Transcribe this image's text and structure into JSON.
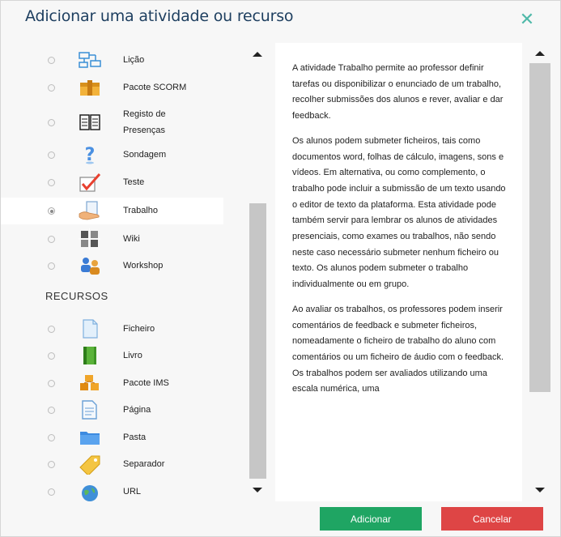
{
  "dialog": {
    "title": "Adicionar uma atividade ou recurso",
    "close_symbol": "✕"
  },
  "activities": [
    {
      "label": "Lição",
      "icon": "lesson-icon",
      "selected": false
    },
    {
      "label": "Pacote SCORM",
      "icon": "scorm-package-icon",
      "selected": false
    },
    {
      "label_line1": "Registo de",
      "label_line2": "Presenças",
      "icon": "attendance-icon",
      "selected": false
    },
    {
      "label": "Sondagem",
      "icon": "survey-icon",
      "selected": false
    },
    {
      "label": "Teste",
      "icon": "quiz-icon",
      "selected": false
    },
    {
      "label": "Trabalho",
      "icon": "assignment-icon",
      "selected": true
    },
    {
      "label": "Wiki",
      "icon": "wiki-icon",
      "selected": false
    },
    {
      "label": "Workshop",
      "icon": "workshop-icon",
      "selected": false
    }
  ],
  "resources_heading": "RECURSOS",
  "resources": [
    {
      "label": "Ficheiro",
      "icon": "file-icon"
    },
    {
      "label": "Livro",
      "icon": "book-icon"
    },
    {
      "label": "Pacote IMS",
      "icon": "ims-package-icon"
    },
    {
      "label": "Página",
      "icon": "page-icon"
    },
    {
      "label": "Pasta",
      "icon": "folder-icon"
    },
    {
      "label": "Separador",
      "icon": "label-tag-icon"
    },
    {
      "label": "URL",
      "icon": "url-globe-icon"
    }
  ],
  "description": {
    "p1": "A atividade Trabalho permite ao professor definir tarefas ou disponibilizar o enunciado de um trabalho, recolher submissões dos alunos e rever, avaliar e dar feedback.",
    "p2": "Os alunos podem submeter ficheiros, tais como documentos word, folhas de cálculo, imagens, sons e vídeos. Em alternativa, ou como complemento, o trabalho pode incluir a submissão de um texto usando o editor de texto da plataforma. Esta atividade pode também servir para lembrar os alunos de atividades presenciais, como exames ou trabalhos, não sendo neste caso necessário submeter nenhum ficheiro ou texto. Os alunos podem submeter o trabalho individualmente ou em grupo.",
    "p3": "Ao avaliar os trabalhos, os professores podem inserir comentários de feedback e submeter ficheiros, nomeadamente o ficheiro de trabalho do aluno com comentários ou um ficheiro de áudio com o feedback. Os trabalhos podem ser avaliados utilizando uma escala numérica, uma"
  },
  "buttons": {
    "add": "Adicionar",
    "cancel": "Cancelar"
  },
  "colors": {
    "title": "#1d3e5f",
    "close": "#50b9a9",
    "add_button": "#1fa563",
    "cancel_button": "#de4545"
  }
}
